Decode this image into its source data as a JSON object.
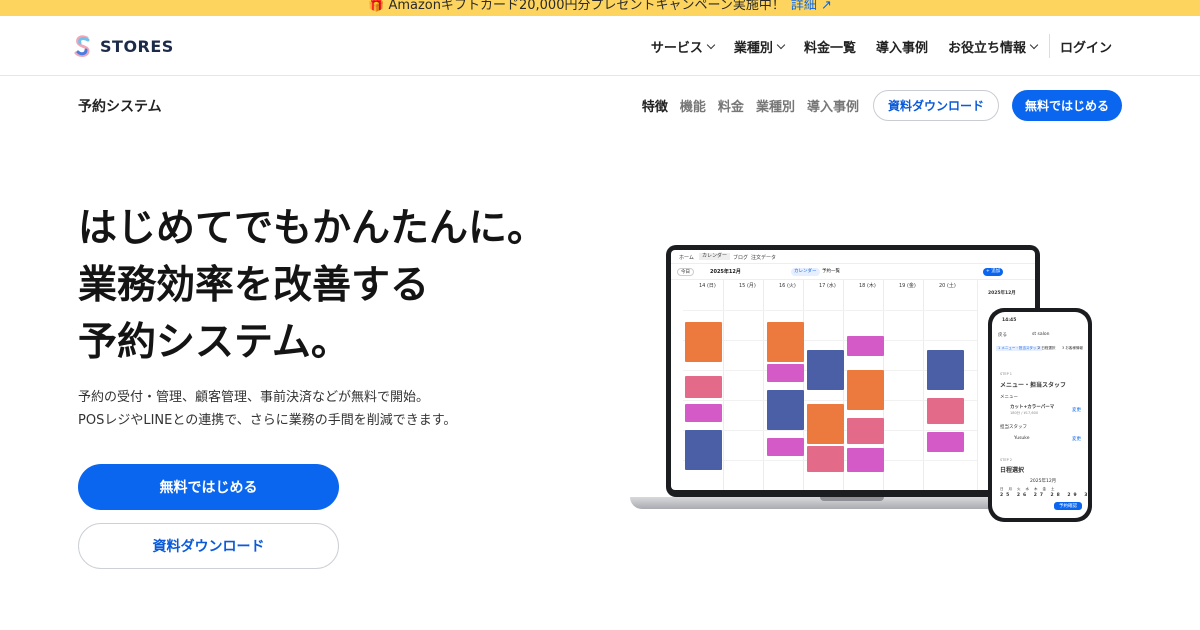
{
  "banner": {
    "text": "🎁 Amazonギフトカード20,000円分プレゼントキャンペーン実施中！",
    "link": "詳細 ↗"
  },
  "brand": {
    "name": "STORES",
    "accent": "#0a66ee",
    "banner_color": "#fdd55e"
  },
  "global_nav": {
    "items": [
      {
        "label": "サービス",
        "has_dropdown": true
      },
      {
        "label": "業種別",
        "has_dropdown": true
      },
      {
        "label": "料金一覧",
        "has_dropdown": false
      },
      {
        "label": "導入事例",
        "has_dropdown": false
      },
      {
        "label": "お役立ち情報",
        "has_dropdown": true
      }
    ],
    "login": "ログイン"
  },
  "sub_nav": {
    "product": "予約システム",
    "items": [
      "特徴",
      "機能",
      "料金",
      "業種別",
      "導入事例"
    ],
    "active_index": 0,
    "download": "資料ダウンロード",
    "start": "無料ではじめる"
  },
  "hero": {
    "title_lines": [
      "はじめてでもかんたんに。",
      "業務効率を改善する",
      "予約システム。"
    ],
    "desc_lines": [
      "予約の受付・管理、顧客管理、事前決済などが無料で開始。",
      "POSレジやLINEとの連携で、さらに業務の手間を削減できます。"
    ],
    "cta_primary": "無料ではじめる",
    "cta_secondary": "資料ダウンロード"
  },
  "mockup": {
    "laptop": {
      "tabs": [
        "ホーム",
        "カレンダー",
        "ブログ",
        "注文データ"
      ],
      "today": "今日",
      "month": "2025年12月",
      "view_chips": [
        "カレンダー",
        "予約一覧"
      ],
      "add": "+ 追加",
      "days": [
        "14 (日)",
        "15 (月)",
        "16 (火)",
        "17 (水)",
        "18 (木)",
        "19 (金)",
        "20 (土)"
      ],
      "side_month": "2025年12月"
    },
    "phone": {
      "time": "14:45",
      "back": "戻る",
      "shop": "st salon",
      "steps": [
        "1 メニュー・担当スタッフ",
        "2 日程選択",
        "3 お客様情報"
      ],
      "step1": "STEP 1",
      "step1_title": "メニュー・担当スタッフ",
      "menu_label": "メニュー",
      "menu_item": "カット+カラーパーマ",
      "menu_price": "180分 / ¥17,600",
      "change": "変更",
      "staff_label": "担当スタッフ",
      "staff": "Yusuke",
      "step2": "STEP 2",
      "step2_title": "日程選択",
      "cal_month": "2025年12月",
      "week_days": [
        "日",
        "月",
        "火",
        "水",
        "木",
        "金",
        "土"
      ],
      "dates": [
        "25",
        "26",
        "27",
        "28",
        "29",
        "30",
        "31"
      ],
      "confirm": "予約確認"
    }
  }
}
